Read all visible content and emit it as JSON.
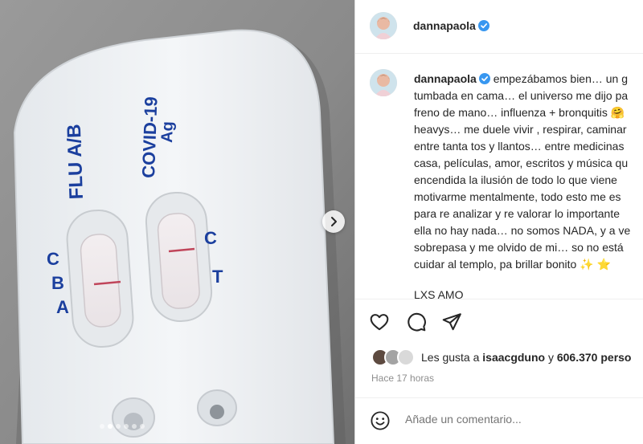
{
  "post": {
    "photo_alt": "",
    "test_kit": {
      "flu_label": "FLU A/B",
      "covid_label": "COVID-19",
      "covid_sub": "Ag",
      "left_letters": [
        "C",
        "B",
        "A"
      ],
      "right_letters": [
        "C",
        "T"
      ]
    },
    "carousel": {
      "dot_count": 6,
      "active_index": 1,
      "next_icon": "chevron-right-icon"
    }
  },
  "header": {
    "username": "dannapaola",
    "verified_icon": "verified-badge-icon"
  },
  "caption": {
    "username": "dannapaola",
    "lines": [
      "empezábamos bien… un g",
      "tumbada en cama… el universo me dijo pa",
      "freno de mano… influenza + bronquitis 🤗",
      "heavys… me duele vivir , respirar, caminar",
      "entre tanta tos y llantos… entre medicinas",
      "casa, películas, amor, escritos y música qu",
      "encendida la ilusión de todo lo que viene",
      "motivarme mentalmente, todo esto me es",
      "para re analizar y re valorar lo importante",
      "ella no hay nada… no somos NADA, y a ve",
      "sobrepasa y me olvido de mi… so no está",
      "cuidar al templo, pa brillar bonito ✨ ⭐"
    ],
    "closing": "LXS AMO"
  },
  "actions": {
    "like_icon": "heart-icon",
    "comment_icon": "comment-bubble-icon",
    "share_icon": "send-icon"
  },
  "likes": {
    "prefix": "Les gusta a",
    "user": "isaacgduno",
    "connector": "y",
    "count": "606.370 perso"
  },
  "timestamp": "Hace 17 horas",
  "comment_box": {
    "emoji_icon": "emoji-smile-icon",
    "placeholder": "Añade un comentario..."
  },
  "colors": {
    "verified_blue": "#3897f0",
    "kit_blue": "#1b3f9e",
    "control_line": "#c0455a",
    "text": "#262626",
    "muted": "#8e8e8e"
  }
}
